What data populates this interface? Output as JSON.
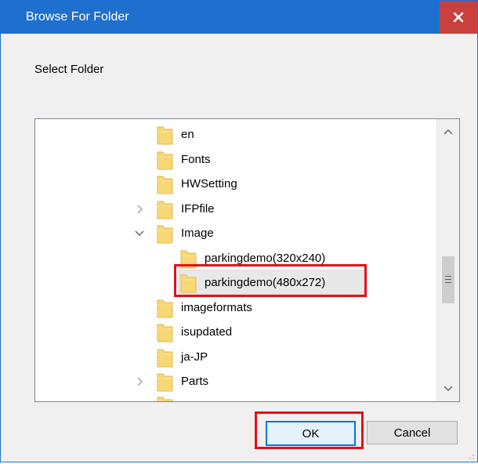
{
  "window": {
    "title": "Browse For Folder",
    "close_icon": "close-icon"
  },
  "dialog": {
    "prompt": "Select Folder"
  },
  "tree": {
    "items": [
      {
        "label": "en",
        "level": 1,
        "expander": "none"
      },
      {
        "label": "Fonts",
        "level": 1,
        "expander": "none"
      },
      {
        "label": "HWSetting",
        "level": 1,
        "expander": "none"
      },
      {
        "label": "IFPfile",
        "level": 1,
        "expander": "collapsed"
      },
      {
        "label": "Image",
        "level": 1,
        "expander": "expanded"
      },
      {
        "label": "parkingdemo(320x240)",
        "level": 2,
        "expander": "none"
      },
      {
        "label": "parkingdemo(480x272)",
        "level": 2,
        "expander": "none",
        "selected": true
      },
      {
        "label": "imageformats",
        "level": 1,
        "expander": "none"
      },
      {
        "label": "isupdated",
        "level": 1,
        "expander": "none"
      },
      {
        "label": "ja-JP",
        "level": 1,
        "expander": "none"
      },
      {
        "label": "Parts",
        "level": 1,
        "expander": "collapsed"
      }
    ]
  },
  "buttons": {
    "ok_label": "OK",
    "cancel_label": "Cancel"
  },
  "colors": {
    "titlebar": "#1f6fce",
    "close_button": "#c8413f",
    "highlight_box": "#e20f16",
    "folder_yellow": "#f8d775"
  }
}
